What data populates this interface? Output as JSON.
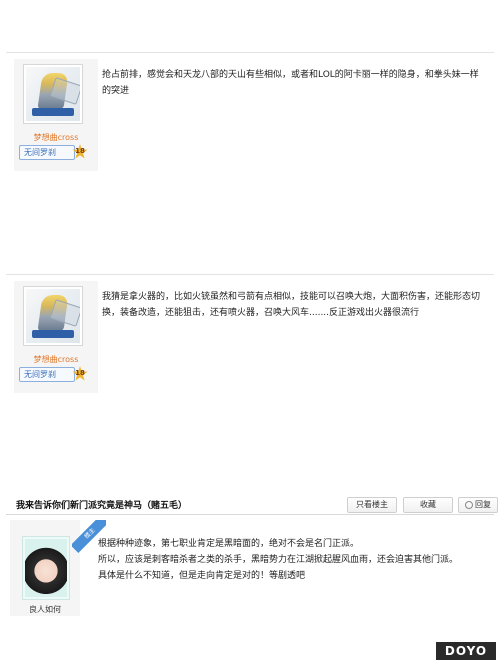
{
  "posts": [
    {
      "author": "梦想曲cross",
      "rank": "无间罗刹",
      "level": "18",
      "text": "抢占前排，感觉会和天龙八部的天山有些相似，或者和LOL的阿卡丽一样的隐身，和拳头妹一样的突进"
    },
    {
      "author": "梦想曲cross",
      "rank": "无间罗刹",
      "level": "18",
      "text": "我猜是拿火器的，比如火铳虽然和弓箭有点相似，技能可以召唤大炮，大面积伤害，还能形态切换，装备改造，还能狙击，还有喷火器，召唤大风车.......反正游戏出火器很流行"
    }
  ],
  "thread": {
    "title": "我来告诉你们新门派究竟是神马（赌五毛）",
    "only_op_label": "只看楼主",
    "favorite_label": "收藏",
    "reply_label": "回复",
    "corner_tag": "楼主",
    "author": "良人如何",
    "lines": [
      "根据种种迹象，第七职业肯定是黑暗面的，绝对不会是名门正派。",
      "所以，应该是刺客暗杀者之类的杀手，黑暗势力在江湖掀起腥风血雨，还会迫害其他门派。",
      "具体是什么不知道，但是走向肯定是对的！等剧透吧"
    ]
  },
  "watermark": "DOYO"
}
